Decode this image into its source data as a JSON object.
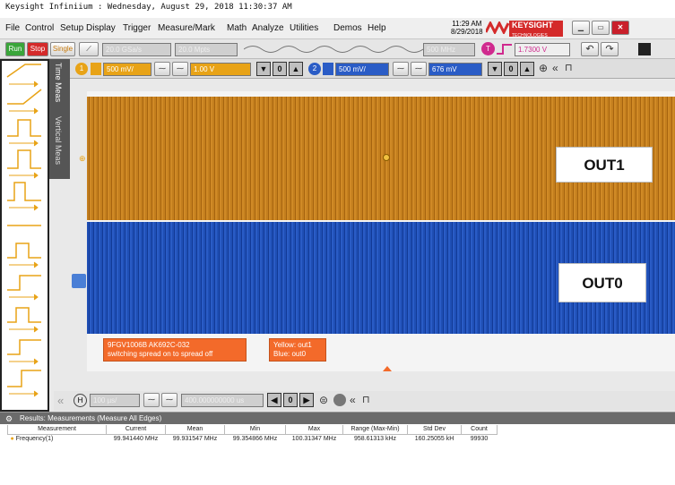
{
  "title_bar": {
    "text": "Keysight Infiniium : Wednesday, August 29, 2018 11:30:37 AM"
  },
  "menu": [
    "File",
    "Control",
    "Setup",
    "Display",
    "Trigger",
    "Measure/Mark",
    "Math",
    "Analyze",
    "Utilities",
    "Demos",
    "Help"
  ],
  "clock": {
    "time": "11:29 AM",
    "date": "8/29/2018"
  },
  "brand": {
    "name": "KEYSIGHT",
    "sub": "TECHNOLOGIES"
  },
  "toolbar": {
    "run": "Run",
    "stop": "Stop",
    "single": "Single",
    "sample_rate": "20.0 GSa/s",
    "memory_depth": "20.0 Mpts",
    "bandwidth": "500 MHz",
    "trigger_level": "1.7300 V"
  },
  "channels": {
    "ch1": {
      "num": "1",
      "scale": "500 mV/",
      "offset": "1.00 V"
    },
    "ch2": {
      "num": "2",
      "scale": "500 mV/",
      "offset": "676 mV"
    }
  },
  "side_tabs": {
    "time": "Time Meas",
    "vertical": "Vertical Meas"
  },
  "traces": {
    "out1_label": "OUT1",
    "out0_label": "OUT0"
  },
  "annotations": {
    "note1_line1": "9FGV1006B AK692C-032",
    "note1_line2": "switching spread on to spread off",
    "note2_line1": "Yellow: out1",
    "note2_line2": "Blue:   out0"
  },
  "horizontal": {
    "scale": "100 µs/",
    "position": "400.000000000 us"
  },
  "results": {
    "header": "Results: Measurements (Measure All Edges)",
    "columns": [
      "Measurement",
      "Current",
      "Mean",
      "Min",
      "Max",
      "Range (Max-Min)",
      "Std Dev",
      "Count"
    ],
    "rows": [
      [
        "Frequency(1)",
        "99.941440 MHz",
        "99.931547 MHz",
        "99.354866 MHz",
        "100.31347 MHz",
        "958.61313 kHz",
        "160.25055 kH",
        "99930"
      ]
    ]
  },
  "colors": {
    "ch1": "#e8a317",
    "ch2": "#2a5cc6",
    "note": "#f36a2a",
    "stop": "#d42a2a",
    "run": "#3aa53a"
  }
}
